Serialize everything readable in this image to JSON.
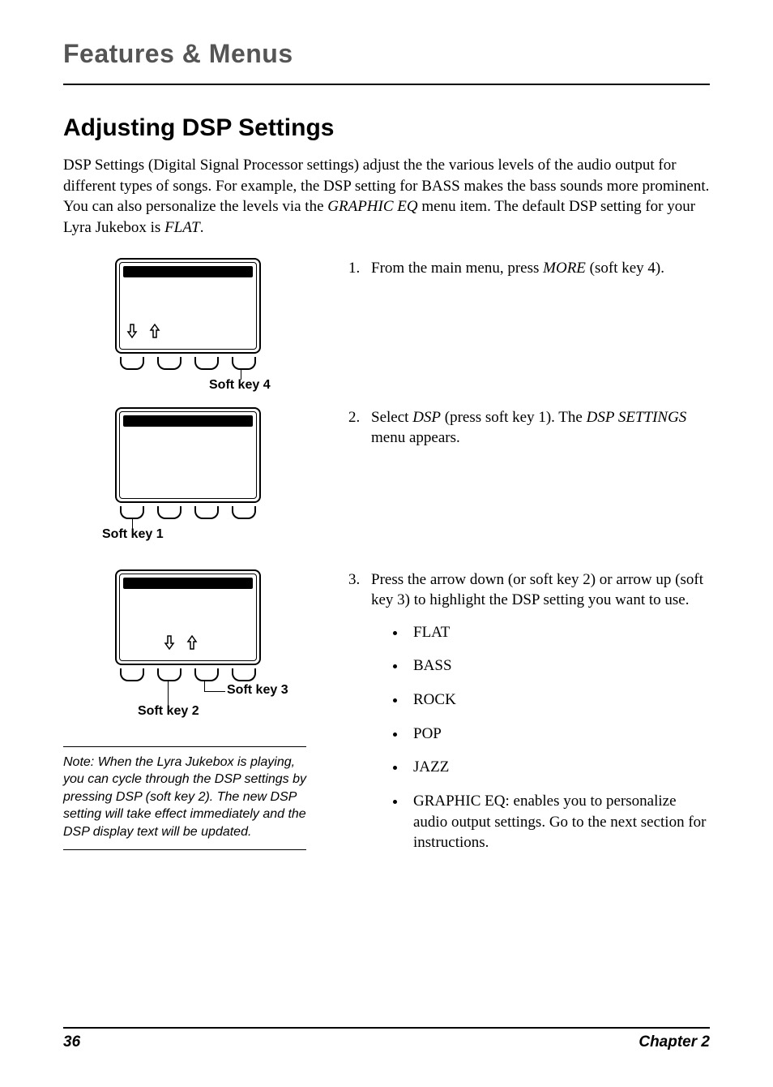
{
  "header": {
    "section": "Features & Menus"
  },
  "title": "Adjusting DSP Settings",
  "intro": {
    "part1": "DSP Settings (Digital Signal Processor settings) adjust the the various levels of the audio output for different types of songs. For example, the DSP setting for BASS makes the bass sounds more prominent. You can also personalize the levels via the ",
    "em1": "GRAPHIC EQ",
    "part2": " menu item. The default DSP setting for your Lyra Jukebox is ",
    "em2": "FLAT",
    "part3": "."
  },
  "steps": {
    "s1": {
      "num": "1.",
      "a": "From the main menu, press ",
      "em": "MORE",
      "b": " (soft key 4)."
    },
    "s2": {
      "num": "2.",
      "a": "Select ",
      "em1": "DSP",
      "b": " (press soft key 1). The ",
      "em2": "DSP SETTINGS",
      "c": " menu appears."
    },
    "s3": {
      "num": "3.",
      "text": "Press the arrow down (or soft key 2) or arrow up (soft key 3) to highlight the DSP setting you want to use."
    }
  },
  "labels": {
    "sk1": "Soft key 1",
    "sk2": "Soft key 2",
    "sk3": "Soft key 3",
    "sk4": "Soft key 4"
  },
  "list": {
    "i1": "FLAT",
    "i2": "BASS",
    "i3": "ROCK",
    "i4": "POP",
    "i5": "JAZZ",
    "i6": "GRAPHIC EQ: enables you to personalize audio output settings. Go to the next section for instructions."
  },
  "note": "Note: When the Lyra Jukebox is playing, you can cycle through the DSP settings by pressing DSP (soft key 2). The new DSP setting will take effect immediately and the DSP display text will be updated.",
  "footer": {
    "page": "36",
    "chapter": "Chapter 2"
  }
}
